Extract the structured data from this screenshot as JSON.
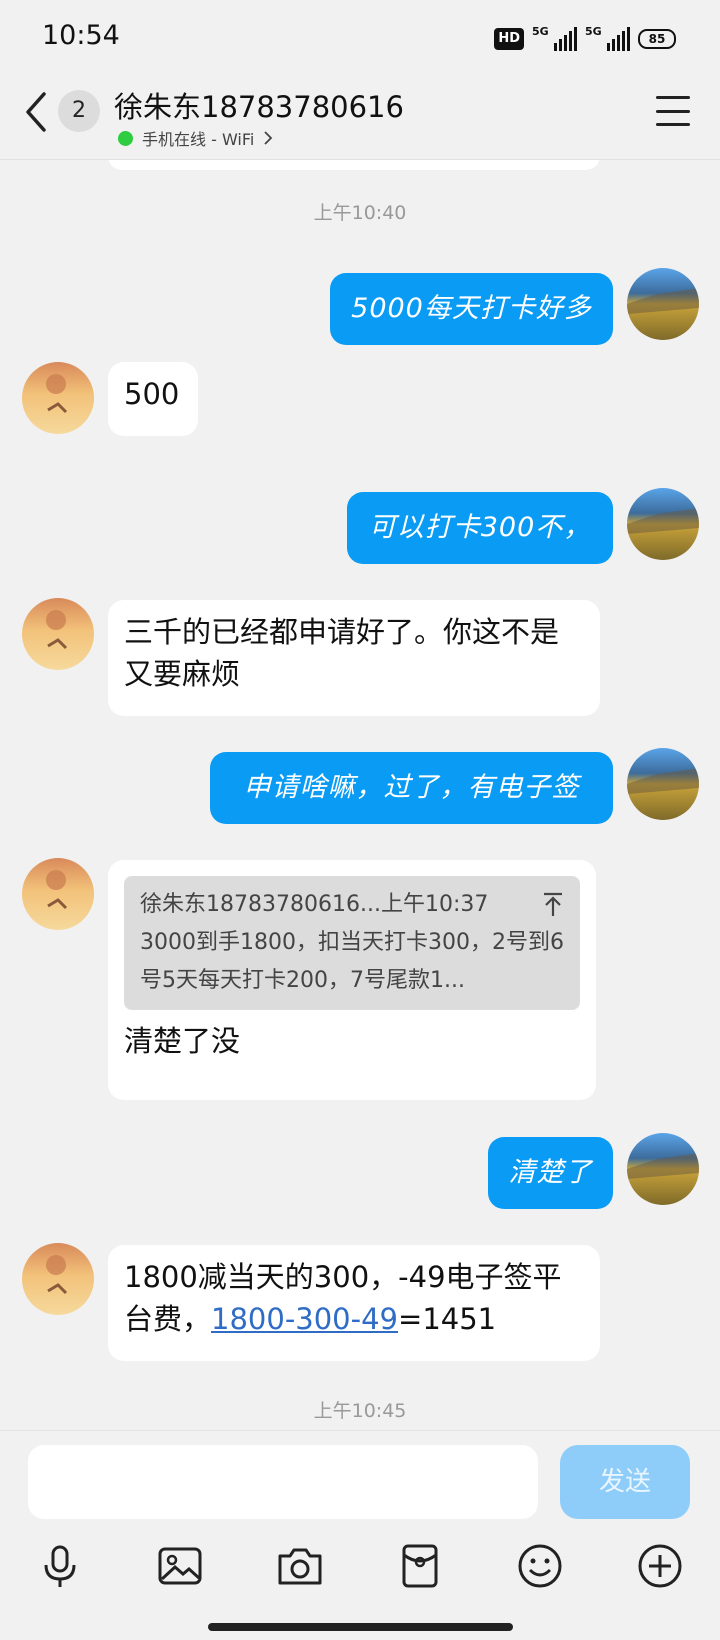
{
  "status": {
    "time": "10:54",
    "hd": "HD",
    "net1": "5G",
    "net2": "5G",
    "battery": "85"
  },
  "header": {
    "unread": "2",
    "contact_name": "徐朱东18783780616",
    "online_status": "手机在线 - WiFi"
  },
  "chat": {
    "time_1": "上午10:40",
    "msg_out_1": "5000每天打卡好多",
    "msg_in_1": "500",
    "msg_out_2": "可以打卡300不，",
    "msg_in_2": "三千的已经都申请好了。你这不是又要麻烦",
    "msg_out_3": "申请啥嘛，过了，有电子签",
    "quote_header": "徐朱东18783780616...上午10:37",
    "quote_text": "3000到手1800，扣当天打卡300，2号到6号5天每天打卡200，7号尾款1...",
    "msg_in_3": "清楚了没",
    "msg_out_4": "清楚了",
    "msg_in_4_prefix": "1800减当天的300，-49电子签平台费，",
    "msg_in_4_link": "1800-300-49",
    "msg_in_4_suffix": "=1451",
    "time_2": "上午10:45"
  },
  "input": {
    "placeholder": "",
    "send_label": "发送"
  },
  "icons": [
    "back-icon",
    "menu-icon",
    "voice-icon",
    "image-icon",
    "camera-icon",
    "red-packet-icon",
    "emoji-icon",
    "plus-icon"
  ],
  "colors": {
    "outgoing_bubble": "#0a9bf5",
    "send_button": "#8ecdf9",
    "link": "#2f6cc6",
    "online_dot": "#2ecc40"
  }
}
